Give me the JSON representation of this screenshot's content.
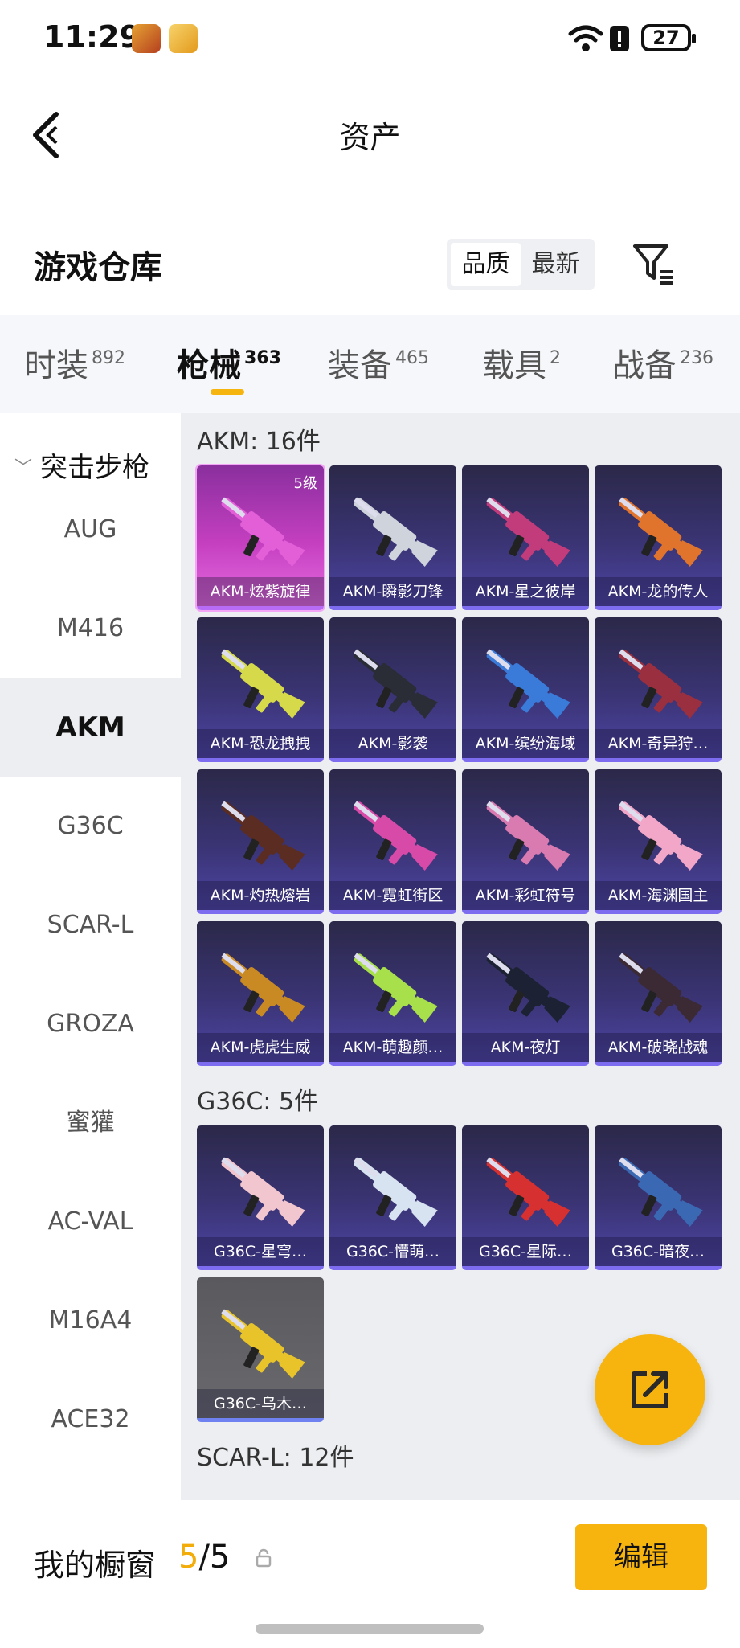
{
  "status": {
    "time": "11:29",
    "battery": "27",
    "app_icons": [
      "game-app-icon",
      "game-app-icon-2"
    ],
    "icons": [
      "wifi-icon",
      "alert-icon",
      "battery-icon"
    ]
  },
  "header": {
    "title": "资产",
    "back_icon": "back-arrow-icon"
  },
  "warehouse": {
    "title": "游戏仓库",
    "sort_options": [
      "品质",
      "最新"
    ],
    "sort_selected": "品质",
    "filter_icon": "filter-icon"
  },
  "tabs": [
    {
      "label": "时装",
      "count": "892",
      "selected": false
    },
    {
      "label": "枪械",
      "count": "363",
      "selected": true
    },
    {
      "label": "装备",
      "count": "465",
      "selected": false
    },
    {
      "label": "载具",
      "count": "2",
      "selected": false
    },
    {
      "label": "战备",
      "count": "236",
      "selected": false
    }
  ],
  "sidebar": {
    "group": "突击步枪",
    "items": [
      {
        "label": "AUG",
        "selected": false
      },
      {
        "label": "M416",
        "selected": false
      },
      {
        "label": "AKM",
        "selected": true
      },
      {
        "label": "G36C",
        "selected": false
      },
      {
        "label": "SCAR-L",
        "selected": false
      },
      {
        "label": "GROZA",
        "selected": false
      },
      {
        "label": "蜜獾",
        "selected": false
      },
      {
        "label": "AC-VAL",
        "selected": false
      },
      {
        "label": "M16A4",
        "selected": false
      },
      {
        "label": "ACE32",
        "selected": false
      }
    ]
  },
  "sections": [
    {
      "title": "AKM: 16件",
      "items": [
        {
          "label": "AKM-炫紫旋律",
          "level": "5级",
          "rarity": "legend"
        },
        {
          "label": "AKM-瞬影刀锋",
          "rarity": "epic"
        },
        {
          "label": "AKM-星之彼岸",
          "rarity": "epic"
        },
        {
          "label": "AKM-龙的传人",
          "rarity": "epic"
        },
        {
          "label": "AKM-恐龙拽拽",
          "rarity": "epic"
        },
        {
          "label": "AKM-影袭",
          "rarity": "epic"
        },
        {
          "label": "AKM-缤纷海域",
          "rarity": "epic"
        },
        {
          "label": "AKM-奇异狩…",
          "rarity": "epic"
        },
        {
          "label": "AKM-灼热熔岩",
          "rarity": "epic"
        },
        {
          "label": "AKM-霓虹街区",
          "rarity": "epic"
        },
        {
          "label": "AKM-彩虹符号",
          "rarity": "epic"
        },
        {
          "label": "AKM-海渊国主",
          "rarity": "epic"
        },
        {
          "label": "AKM-虎虎生威",
          "rarity": "epic"
        },
        {
          "label": "AKM-萌趣颜…",
          "rarity": "epic"
        },
        {
          "label": "AKM-夜灯",
          "rarity": "epic"
        },
        {
          "label": "AKM-破晓战魂",
          "rarity": "epic"
        }
      ]
    },
    {
      "title": "G36C: 5件",
      "items": [
        {
          "label": "G36C-星穹…",
          "rarity": "epic"
        },
        {
          "label": "G36C-懵萌…",
          "rarity": "epic"
        },
        {
          "label": "G36C-星际…",
          "rarity": "epic"
        },
        {
          "label": "G36C-暗夜…",
          "rarity": "epic"
        },
        {
          "label": "G36C-乌木…",
          "rarity": "grey"
        }
      ]
    },
    {
      "title": "SCAR-L: 12件",
      "items": []
    }
  ],
  "fab": {
    "icon": "share-icon"
  },
  "bottom": {
    "label": "我的橱窗",
    "current": "5",
    "total": "/5",
    "lock_icon": "lock-icon",
    "edit_label": "编辑"
  },
  "colors": {
    "accent": "#f7b40f",
    "epic_bg": "#3a3474",
    "legend_bg": "#c43fc0"
  }
}
